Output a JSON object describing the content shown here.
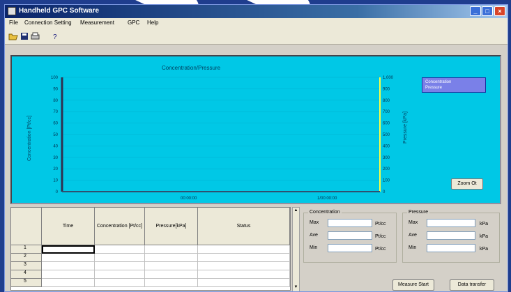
{
  "window": {
    "title": "Handheld GPC Software"
  },
  "menu": [
    "File",
    "Connection Setting",
    "Measurement",
    "GPC",
    "Help"
  ],
  "toolbar": [
    "open-icon",
    "save-icon",
    "print-icon",
    "help-icon"
  ],
  "chart": {
    "title": "Concentration/Pressure",
    "left_axis_title": "Concentration [Pt/cc]",
    "right_axis_title": "Pressure [kPa]",
    "left_ticks": [
      "100",
      "90",
      "80",
      "70",
      "60",
      "50",
      "40",
      "30",
      "20",
      "10",
      "0"
    ],
    "right_ticks": [
      "1,000",
      "900",
      "800",
      "700",
      "600",
      "500",
      "400",
      "300",
      "200",
      "100",
      "0"
    ],
    "x_ticks": [
      "00:00:00",
      "1/00:00:00"
    ],
    "legend": [
      "Concentration",
      "Pressure"
    ],
    "zoom_label": "Zoom Ot"
  },
  "chart_data": {
    "type": "line",
    "title": "Concentration/Pressure",
    "ylabel": "Concentration [Pt/cc]",
    "y2label": "Pressure [kPa]",
    "ylim": [
      0,
      100
    ],
    "y2lim": [
      0,
      1000
    ],
    "x_tick_labels": [
      "00:00:00",
      "1/00:00:00"
    ],
    "series": [
      {
        "name": "Concentration",
        "values": []
      },
      {
        "name": "Pressure",
        "values": []
      }
    ],
    "legend_position": "top-right",
    "grid": false
  },
  "table": {
    "columns": [
      "Time",
      "Concentration [Pt/cc]",
      "Pressure[kPa]",
      "Status"
    ],
    "rows": [
      "1",
      "2",
      "3",
      "4",
      "5"
    ]
  },
  "concentration_group": {
    "label": "Concentration",
    "max_label": "Max",
    "ave_label": "Ave",
    "min_label": "Min",
    "unit": "Pt/cc"
  },
  "pressure_group": {
    "label": "Pressure",
    "max_label": "Max",
    "ave_label": "Ave",
    "min_label": "Min",
    "unit": "kPa"
  },
  "buttons": {
    "measure_start": "Measure Start",
    "data_transfer": "Data transfer"
  },
  "colors": {
    "chart_bg": "#00c8e6",
    "titlebar": "#0a246a",
    "pressure_line": "#ffff40",
    "concentration_line": "#303050"
  }
}
